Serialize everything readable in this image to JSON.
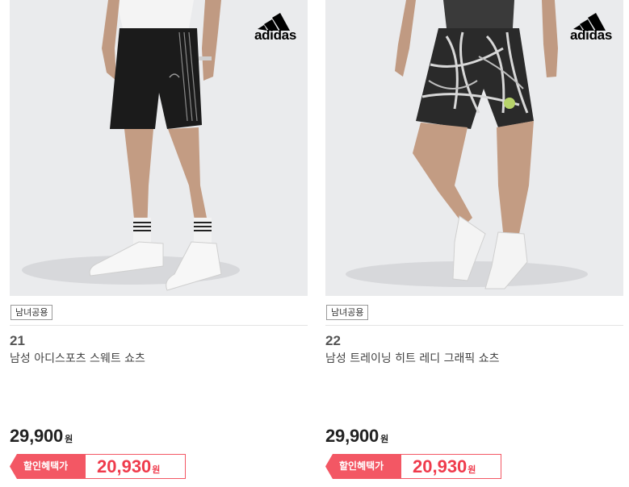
{
  "products": [
    {
      "image_alt": "",
      "brand": "adidas",
      "badge": "남녀공용",
      "rank": "21",
      "title": "남성 아디스포츠 스웨트 쇼츠",
      "price": "29,900",
      "price_unit": "원",
      "sale_label": "할인혜택가",
      "sale_price": "20,930",
      "sale_unit": "원"
    },
    {
      "image_alt": "",
      "brand": "adidas",
      "badge": "남녀공용",
      "rank": "22",
      "title": "남성 트레이닝 히트 레디 그래픽 쇼츠",
      "price": "29,900",
      "price_unit": "원",
      "sale_label": "할인혜택가",
      "sale_price": "20,930",
      "sale_unit": "원"
    }
  ],
  "colors": {
    "accent": "#f35764",
    "sale_text": "#ef3b4c",
    "image_bg": "#eaebed"
  }
}
